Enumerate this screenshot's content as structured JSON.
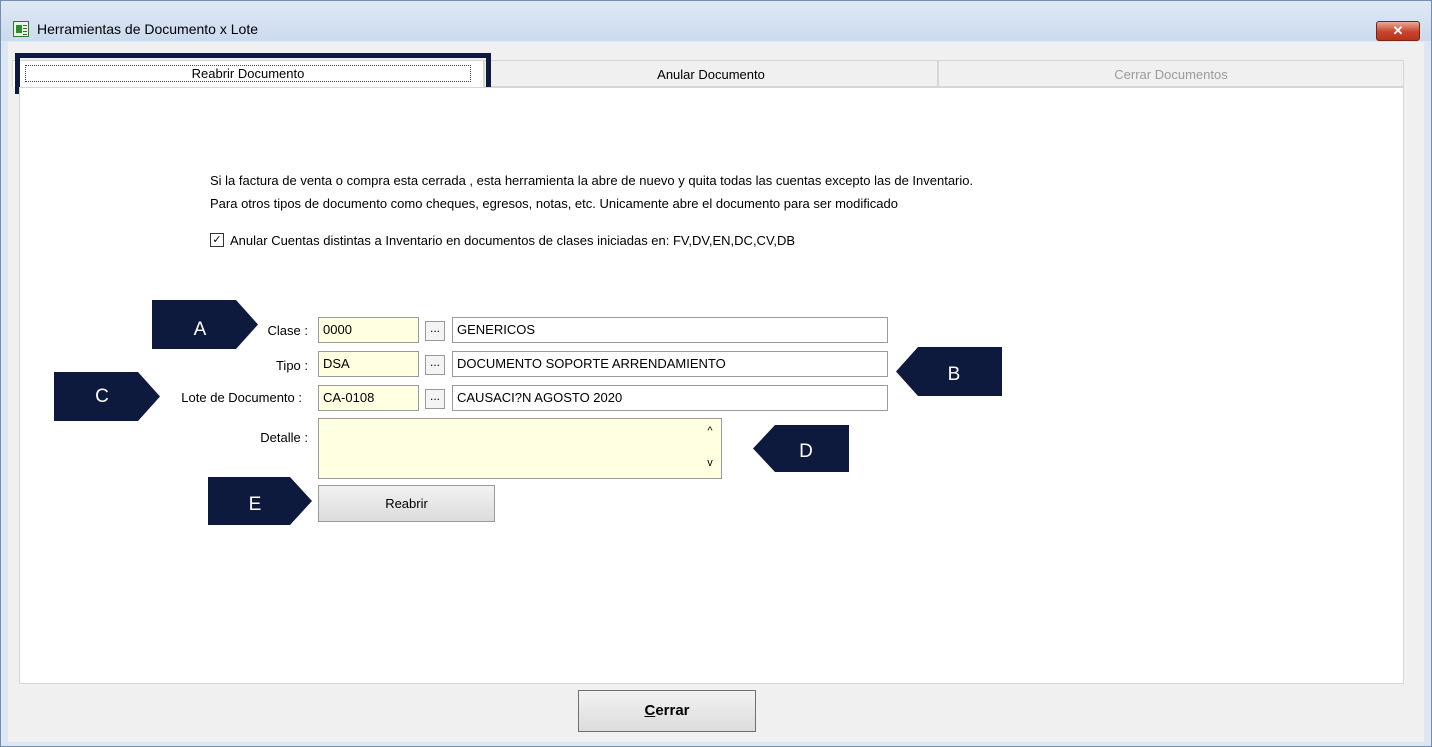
{
  "window": {
    "title": "Herramientas de Documento x Lote",
    "close_glyph": "✕"
  },
  "tabs": [
    {
      "label": "Reabrir Documento",
      "state": "active"
    },
    {
      "label": "Anular Documento",
      "state": "normal"
    },
    {
      "label": "Cerrar Documentos",
      "state": "disabled"
    }
  ],
  "info": {
    "line1": "Si la factura de venta o compra esta cerrada , esta herramienta la abre de  nuevo y quita todas las cuentas excepto las de Inventario.",
    "line2": "Para otros tipos de documento como cheques, egresos, notas, etc. Unicamente abre el documento para ser modificado"
  },
  "checkbox": {
    "checked": true,
    "mark": "✓",
    "label": "Anular Cuentas distintas a Inventario en documentos de clases iniciadas en: FV,DV,EN,DC,CV,DB"
  },
  "form": {
    "clase": {
      "label": "Clase :",
      "code": "0000",
      "browse": "...",
      "description": "GENERICOS"
    },
    "tipo": {
      "label": "Tipo :",
      "code": "DSA",
      "browse": "...",
      "description": "DOCUMENTO SOPORTE ARRENDAMIENTO"
    },
    "lote": {
      "label": "Lote de Documento :",
      "code": "CA-0108",
      "browse": "...",
      "description": "CAUSACI?N AGOSTO 2020"
    },
    "detalle": {
      "label": "Detalle :",
      "value": "",
      "scroll_up": "^",
      "scroll_down": "v"
    }
  },
  "buttons": {
    "reabrir": "Reabrir",
    "cerrar_mnemonic": "C",
    "cerrar_rest": "errar"
  },
  "markers": [
    "A",
    "B",
    "C",
    "D",
    "E"
  ],
  "colors": {
    "marker": "#0d1a3e",
    "input_bg": "#ffffe1",
    "disabled_text": "#9b9b9b"
  }
}
